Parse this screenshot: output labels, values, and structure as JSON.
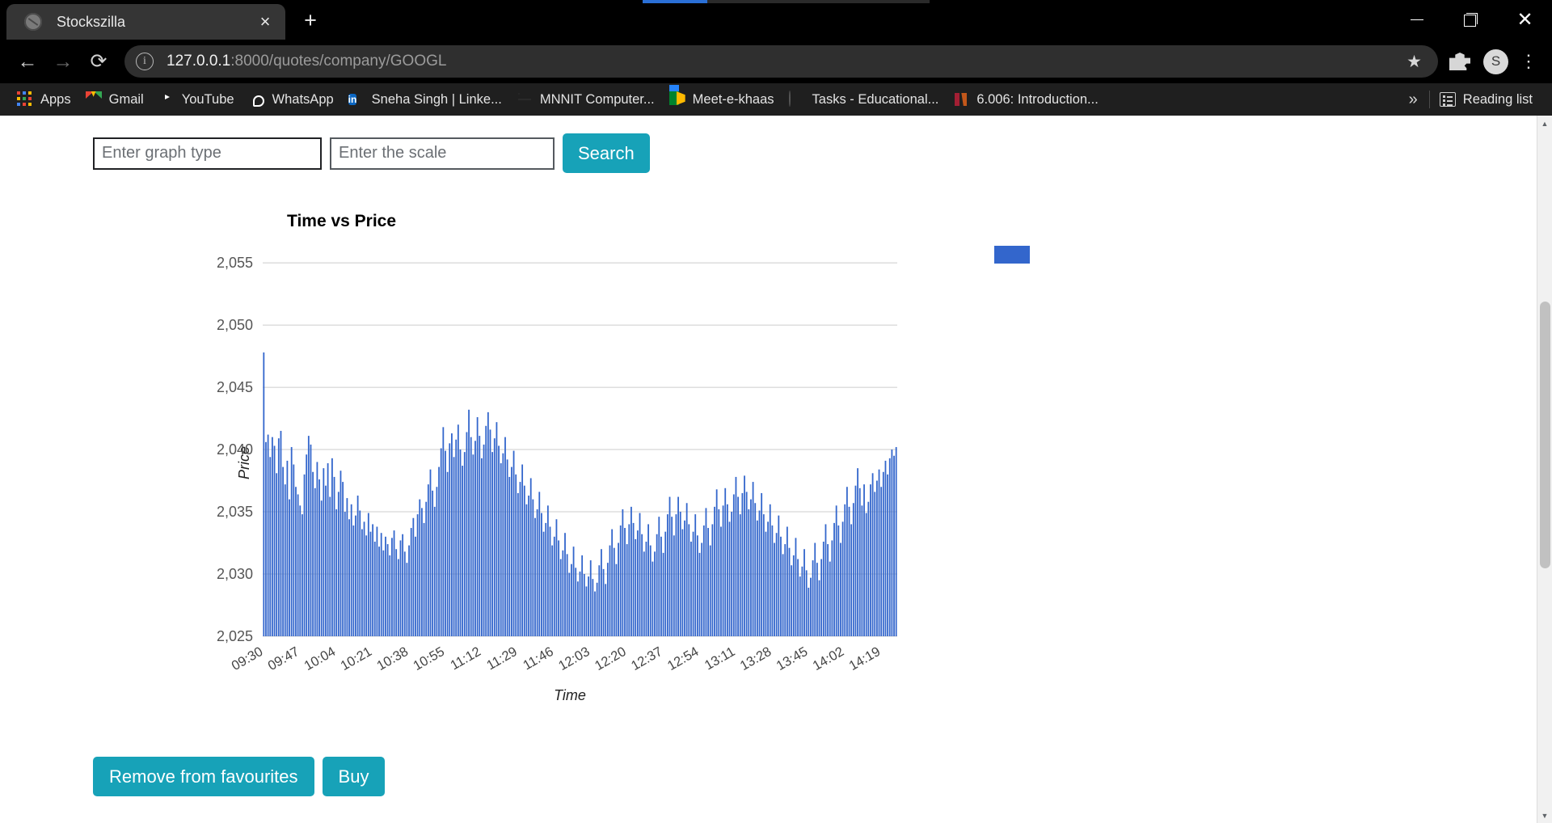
{
  "browser": {
    "tab": {
      "title": "Stockszilla",
      "favicon_icon": "globe-icon",
      "close_icon": "×"
    },
    "new_tab_label": "+",
    "window_controls": {
      "minimize": "minimize-icon",
      "maximize": "restore-icon",
      "close": "close-icon"
    },
    "nav": {
      "back": "back-arrow-icon",
      "forward": "forward-arrow-icon",
      "reload": "reload-icon"
    },
    "omnibox": {
      "info_icon": "info-circle-icon",
      "url_host": "127.0.0.1",
      "url_path": ":8000/quotes/company/GOOGL",
      "star_icon": "★",
      "extensions_icon": "puzzle-piece-icon",
      "avatar_initial": "S",
      "menu_icon": "⋮"
    },
    "bookmarks": [
      {
        "label": "Apps",
        "icon": "apps-grid-icon"
      },
      {
        "label": "Gmail",
        "icon": "gmail-icon"
      },
      {
        "label": "YouTube",
        "icon": "youtube-icon"
      },
      {
        "label": "WhatsApp",
        "icon": "whatsapp-icon"
      },
      {
        "label": "Sneha Singh | Linke...",
        "icon": "linkedin-icon"
      },
      {
        "label": "MNNIT Computer...",
        "icon": "globe-icon"
      },
      {
        "label": "Meet-e-khaas",
        "icon": "google-meet-icon"
      },
      {
        "label": "Tasks - Educational...",
        "icon": "generic-site-icon"
      },
      {
        "label": "6.006: Introduction...",
        "icon": "mit-icon"
      }
    ],
    "bookmarks_overflow": "»",
    "reading_list": {
      "label": "Reading list",
      "icon": "reading-list-icon"
    }
  },
  "page": {
    "search_form": {
      "graph_type_placeholder": "Enter graph type",
      "graph_type_value": "",
      "scale_placeholder": "Enter the scale",
      "scale_value": "",
      "search_label": "Search"
    },
    "actions": {
      "favourite_label": "Remove from favourites",
      "buy_label": "Buy"
    },
    "scrollbar": {
      "up_icon": "▲",
      "down_icon": "▼"
    }
  },
  "chart_data": {
    "type": "bar",
    "title": "Time vs Price",
    "xlabel": "Time",
    "ylabel": "Price",
    "ylim": [
      2025,
      2056.5
    ],
    "yticks": [
      "2,025",
      "2,030",
      "2,035",
      "2,040",
      "2,045",
      "2,050",
      "2,055"
    ],
    "ytick_values": [
      2025,
      2030,
      2035,
      2040,
      2045,
      2050,
      2055
    ],
    "grid": true,
    "legend_position": "right",
    "legend": [
      {
        "name": "",
        "color": "#3366cc"
      }
    ],
    "bar_color": "#3366cc",
    "xtick_labels": [
      "09:30",
      "09:47",
      "10:04",
      "10:21",
      "10:38",
      "10:55",
      "11:12",
      "11:29",
      "11:46",
      "12:03",
      "12:20",
      "12:37",
      "12:54",
      "13:11",
      "13:28",
      "13:45",
      "14:02",
      "14:19"
    ],
    "xtick_interval_minutes": 17,
    "x_start": "09:30",
    "x_end": "14:28",
    "x": [
      "09:30",
      "09:31",
      "09:32",
      "09:33",
      "09:34",
      "09:35",
      "09:36",
      "09:37",
      "09:38",
      "09:39",
      "09:40",
      "09:41",
      "09:42",
      "09:43",
      "09:44",
      "09:45",
      "09:46",
      "09:47",
      "09:48",
      "09:49",
      "09:50",
      "09:51",
      "09:52",
      "09:53",
      "09:54",
      "09:55",
      "09:56",
      "09:57",
      "09:58",
      "09:59",
      "10:00",
      "10:01",
      "10:02",
      "10:03",
      "10:04",
      "10:05",
      "10:06",
      "10:07",
      "10:08",
      "10:09",
      "10:10",
      "10:11",
      "10:12",
      "10:13",
      "10:14",
      "10:15",
      "10:16",
      "10:17",
      "10:18",
      "10:19",
      "10:20",
      "10:21",
      "10:22",
      "10:23",
      "10:24",
      "10:25",
      "10:26",
      "10:27",
      "10:28",
      "10:29",
      "10:30",
      "10:31",
      "10:32",
      "10:33",
      "10:34",
      "10:35",
      "10:36",
      "10:37",
      "10:38",
      "10:39",
      "10:40",
      "10:41",
      "10:42",
      "10:43",
      "10:44",
      "10:45",
      "10:46",
      "10:47",
      "10:48",
      "10:49",
      "10:50",
      "10:51",
      "10:52",
      "10:53",
      "10:54",
      "10:55",
      "10:56",
      "10:57",
      "10:58",
      "10:59",
      "11:00",
      "11:01",
      "11:02",
      "11:03",
      "11:04",
      "11:05",
      "11:06",
      "11:07",
      "11:08",
      "11:09",
      "11:10",
      "11:11",
      "11:12",
      "11:13",
      "11:14",
      "11:15",
      "11:16",
      "11:17",
      "11:18",
      "11:19",
      "11:20",
      "11:21",
      "11:22",
      "11:23",
      "11:24",
      "11:25",
      "11:26",
      "11:27",
      "11:28",
      "11:29",
      "11:30",
      "11:31",
      "11:32",
      "11:33",
      "11:34",
      "11:35",
      "11:36",
      "11:37",
      "11:38",
      "11:39",
      "11:40",
      "11:41",
      "11:42",
      "11:43",
      "11:44",
      "11:45",
      "11:46",
      "11:47",
      "11:48",
      "11:49",
      "11:50",
      "11:51",
      "11:52",
      "11:53",
      "11:54",
      "11:55",
      "11:56",
      "11:57",
      "11:58",
      "11:59",
      "12:00",
      "12:01",
      "12:02",
      "12:03",
      "12:04",
      "12:05",
      "12:06",
      "12:07",
      "12:08",
      "12:09",
      "12:10",
      "12:11",
      "12:12",
      "12:13",
      "12:14",
      "12:15",
      "12:16",
      "12:17",
      "12:18",
      "12:19",
      "12:20",
      "12:21",
      "12:22",
      "12:23",
      "12:24",
      "12:25",
      "12:26",
      "12:27",
      "12:28",
      "12:29",
      "12:30",
      "12:31",
      "12:32",
      "12:33",
      "12:34",
      "12:35",
      "12:36",
      "12:37",
      "12:38",
      "12:39",
      "12:40",
      "12:41",
      "12:42",
      "12:43",
      "12:44",
      "12:45",
      "12:46",
      "12:47",
      "12:48",
      "12:49",
      "12:50",
      "12:51",
      "12:52",
      "12:53",
      "12:54",
      "12:55",
      "12:56",
      "12:57",
      "12:58",
      "12:59",
      "13:00",
      "13:01",
      "13:02",
      "13:03",
      "13:04",
      "13:05",
      "13:06",
      "13:07",
      "13:08",
      "13:09",
      "13:10",
      "13:11",
      "13:12",
      "13:13",
      "13:14",
      "13:15",
      "13:16",
      "13:17",
      "13:18",
      "13:19",
      "13:20",
      "13:21",
      "13:22",
      "13:23",
      "13:24",
      "13:25",
      "13:26",
      "13:27",
      "13:28",
      "13:29",
      "13:30",
      "13:31",
      "13:32",
      "13:33",
      "13:34",
      "13:35",
      "13:36",
      "13:37",
      "13:38",
      "13:39",
      "13:40",
      "13:41",
      "13:42",
      "13:43",
      "13:44",
      "13:45",
      "13:46",
      "13:47",
      "13:48",
      "13:49",
      "13:50",
      "13:51",
      "13:52",
      "13:53",
      "13:54",
      "13:55",
      "13:56",
      "13:57",
      "13:58",
      "13:59",
      "14:00",
      "14:01",
      "14:02",
      "14:03",
      "14:04",
      "14:05",
      "14:06",
      "14:07",
      "14:08",
      "14:09",
      "14:10",
      "14:11",
      "14:12",
      "14:13",
      "14:14",
      "14:15",
      "14:16",
      "14:17",
      "14:18",
      "14:19",
      "14:20",
      "14:21",
      "14:22",
      "14:23",
      "14:24",
      "14:25",
      "14:26",
      "14:27",
      "14:28"
    ],
    "values": [
      2047.8,
      2040.6,
      2041.2,
      2039.4,
      2041.0,
      2040.3,
      2038.1,
      2040.9,
      2041.5,
      2038.6,
      2037.2,
      2039.1,
      2036.0,
      2040.2,
      2038.8,
      2037.0,
      2036.4,
      2035.5,
      2034.8,
      2038.0,
      2039.6,
      2041.1,
      2040.4,
      2038.2,
      2036.9,
      2039.0,
      2037.6,
      2035.9,
      2038.5,
      2037.1,
      2038.9,
      2036.2,
      2039.3,
      2037.8,
      2035.2,
      2036.6,
      2038.3,
      2037.4,
      2035.0,
      2036.1,
      2034.4,
      2035.6,
      2033.9,
      2034.7,
      2036.3,
      2035.1,
      2033.6,
      2034.2,
      2033.1,
      2034.9,
      2033.4,
      2034.0,
      2032.6,
      2033.8,
      2032.2,
      2033.3,
      2031.9,
      2033.0,
      2032.4,
      2031.5,
      2032.9,
      2033.5,
      2032.0,
      2031.2,
      2032.7,
      2033.2,
      2031.8,
      2030.9,
      2032.3,
      2033.7,
      2034.5,
      2033.0,
      2034.8,
      2036.0,
      2035.3,
      2034.1,
      2035.8,
      2037.2,
      2038.4,
      2036.7,
      2035.4,
      2037.0,
      2038.6,
      2040.1,
      2041.8,
      2039.9,
      2038.2,
      2040.5,
      2041.3,
      2039.4,
      2040.8,
      2042.0,
      2040.0,
      2038.7,
      2039.8,
      2041.4,
      2043.2,
      2041.0,
      2039.6,
      2040.7,
      2042.6,
      2041.1,
      2039.3,
      2040.4,
      2041.9,
      2043.0,
      2041.6,
      2039.8,
      2040.9,
      2042.2,
      2040.3,
      2038.9,
      2039.7,
      2041.0,
      2039.2,
      2037.8,
      2038.6,
      2039.9,
      2038.0,
      2036.5,
      2037.4,
      2038.8,
      2037.1,
      2035.6,
      2036.3,
      2037.7,
      2036.0,
      2034.5,
      2035.2,
      2036.6,
      2034.9,
      2033.4,
      2034.1,
      2035.5,
      2033.8,
      2032.3,
      2033.0,
      2034.4,
      2032.7,
      2031.2,
      2031.9,
      2033.3,
      2031.6,
      2030.1,
      2030.8,
      2032.2,
      2030.5,
      2029.4,
      2030.2,
      2031.5,
      2030.0,
      2029.0,
      2029.8,
      2031.1,
      2029.6,
      2028.6,
      2029.3,
      2030.7,
      2032.0,
      2030.4,
      2029.2,
      2030.9,
      2032.3,
      2033.6,
      2032.1,
      2030.8,
      2032.5,
      2033.9,
      2035.2,
      2033.7,
      2032.4,
      2034.0,
      2035.4,
      2034.1,
      2032.8,
      2033.5,
      2034.9,
      2033.2,
      2031.8,
      2032.6,
      2034.0,
      2032.3,
      2031.0,
      2031.8,
      2033.2,
      2034.6,
      2033.0,
      2031.7,
      2033.4,
      2034.8,
      2036.2,
      2034.6,
      2033.1,
      2034.8,
      2036.2,
      2035.0,
      2033.6,
      2034.3,
      2035.7,
      2034.0,
      2032.6,
      2033.4,
      2034.8,
      2033.1,
      2031.7,
      2032.5,
      2033.9,
      2035.3,
      2033.7,
      2032.3,
      2034.0,
      2035.4,
      2036.8,
      2035.2,
      2033.8,
      2035.5,
      2036.9,
      2035.6,
      2034.2,
      2035.0,
      2036.4,
      2037.8,
      2036.2,
      2034.8,
      2036.5,
      2037.9,
      2036.6,
      2035.2,
      2036.0,
      2037.4,
      2035.7,
      2034.3,
      2035.1,
      2036.5,
      2034.8,
      2033.4,
      2034.2,
      2035.6,
      2033.9,
      2032.5,
      2033.3,
      2034.7,
      2033.0,
      2031.6,
      2032.4,
      2033.8,
      2032.1,
      2030.7,
      2031.5,
      2032.9,
      2031.2,
      2029.8,
      2030.6,
      2032.0,
      2030.3,
      2028.9,
      2029.7,
      2031.1,
      2032.5,
      2030.9,
      2029.5,
      2031.2,
      2032.6,
      2034.0,
      2032.4,
      2031.0,
      2032.7,
      2034.1,
      2035.5,
      2033.9,
      2032.5,
      2034.2,
      2035.6,
      2037.0,
      2035.4,
      2034.0,
      2035.7,
      2037.1,
      2038.5,
      2036.9,
      2035.5,
      2037.2,
      2034.9,
      2035.8,
      2037.2,
      2038.1,
      2036.6,
      2037.5,
      2038.4,
      2037.0,
      2038.2,
      2039.1,
      2038.0,
      2039.3,
      2040.0,
      2039.5,
      2040.2
    ]
  }
}
